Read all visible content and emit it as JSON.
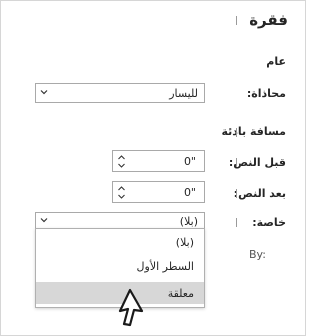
{
  "pane": {
    "title": "فقرة",
    "general_heading": "عام",
    "alignment_label": "محاذاة:",
    "alignment_value": "لليسار",
    "spacing_heading": "مسافة بادئة",
    "before_label": "قبل النص:",
    "before_value": "0\"",
    "after_label": "بعد النص:",
    "after_value": "0\"",
    "special_label": "خاصة:",
    "special_value": "(بلا)",
    "by_label": "By:",
    "special_options": [
      {
        "label": "(بلا)"
      },
      {
        "label": "السطر الأول"
      },
      {
        "label": "معلقة"
      }
    ]
  }
}
